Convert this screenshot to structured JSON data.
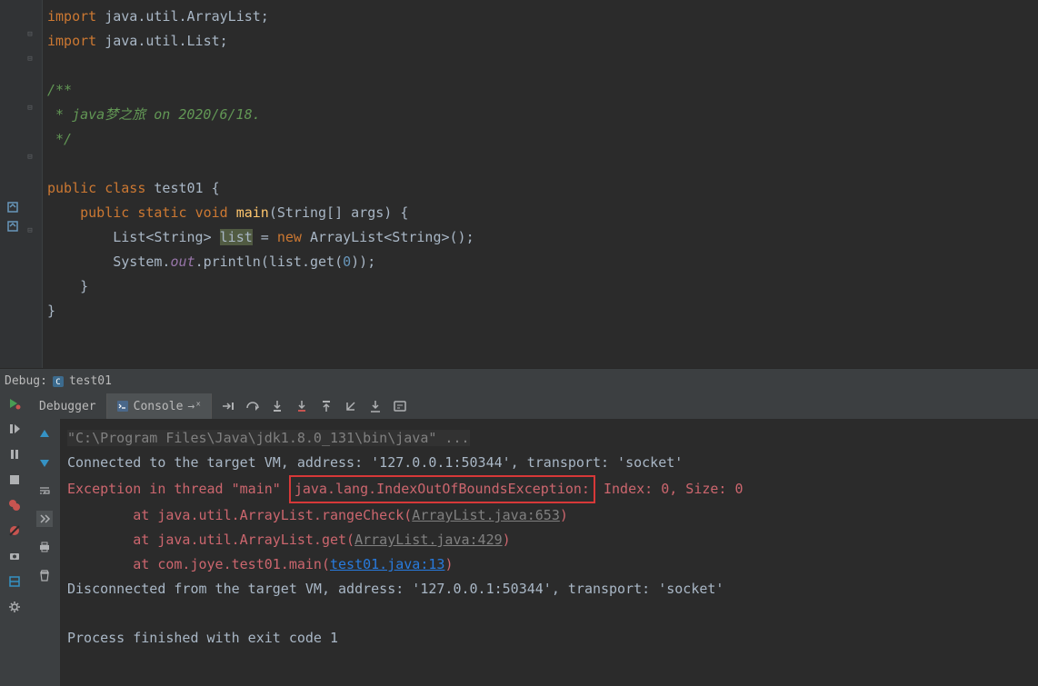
{
  "code": {
    "line1_import": "import",
    "line1_rest": " java.util.ArrayList;",
    "line2_import": "import",
    "line2_rest": " java.util.List;",
    "doc_start": "/**",
    "doc_body": " * java梦之旅 on 2020/6/18.",
    "doc_end": " */",
    "class_public": "public",
    "class_class": "class",
    "class_name": "test01",
    "class_brace": "{",
    "main_public": "public",
    "main_static": "static",
    "main_void": "void",
    "main_name": "main",
    "main_args": "(String[] args) {",
    "list_decl1": "List<String> ",
    "list_var": "list",
    "list_decl2": " = ",
    "list_new": "new",
    "list_decl3": " ArrayList<String>();",
    "sys": "System.",
    "out": "out",
    "println": ".println",
    "get_call1": "(list.get(",
    "get_num": "0",
    "get_call2": "));",
    "close1": "}",
    "close2": "}"
  },
  "debug": {
    "label": "Debug:",
    "tab_name": "test01"
  },
  "tabs": {
    "debugger": "Debugger",
    "console": "Console"
  },
  "console": {
    "cmdline": "\"C:\\Program Files\\Java\\jdk1.8.0_131\\bin\\java\" ...",
    "connected": "Connected to the target VM, address: '127.0.0.1:50344', transport: 'socket'",
    "exc_prefix": "Exception in thread \"main\" ",
    "exc_boxed": "java.lang.IndexOutOfBoundsException:",
    "exc_suffix": " Index: 0, Size: 0",
    "at1_pre": "\tat java.util.ArrayList.rangeCheck(",
    "at1_link": "ArrayList.java:653",
    "at1_post": ")",
    "at2_pre": "\tat java.util.ArrayList.get(",
    "at2_link": "ArrayList.java:429",
    "at2_post": ")",
    "at3_pre": "\tat com.joye.test01.main(",
    "at3_link": "test01.java:13",
    "at3_post": ")",
    "disconnected": "Disconnected from the target VM, address: '127.0.0.1:50344', transport: 'socket'",
    "exit": "Process finished with exit code 1"
  }
}
